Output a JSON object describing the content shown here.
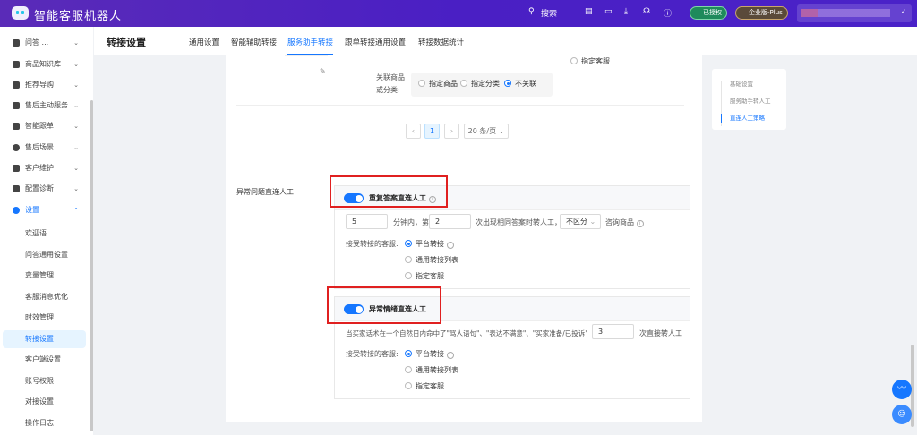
{
  "topbar": {
    "brand": "智能客服机器人",
    "search": "搜索",
    "authorized": "已授权",
    "edition": "企业版-Plus"
  },
  "sidebar": {
    "groups": [
      {
        "label": "问答 ..."
      },
      {
        "label": "商品知识库"
      },
      {
        "label": "推荐导购"
      },
      {
        "label": "售后主动服务"
      },
      {
        "label": "智能跟单"
      },
      {
        "label": "售后场景"
      },
      {
        "label": "客户维护"
      },
      {
        "label": "配置诊断"
      },
      {
        "label": "设置"
      }
    ],
    "sub_items": [
      {
        "label": "欢迎语"
      },
      {
        "label": "问答通用设置"
      },
      {
        "label": "变量管理"
      },
      {
        "label": "客服消息优化"
      },
      {
        "label": "时效管理"
      },
      {
        "label": "转接设置"
      },
      {
        "label": "客户端设置"
      },
      {
        "label": "账号权限"
      },
      {
        "label": "对接设置"
      },
      {
        "label": "操作日志"
      }
    ]
  },
  "header": {
    "title": "转接设置",
    "tabs": [
      {
        "label": "通用设置"
      },
      {
        "label": "智能辅助转接"
      },
      {
        "label": "服务助手转接"
      },
      {
        "label": "跟单转接通用设置"
      },
      {
        "label": "转接数据统计"
      }
    ]
  },
  "upper": {
    "assign_cs": "指定客服",
    "related_label": "关联商品或分类:",
    "related_options": [
      {
        "label": "指定商品"
      },
      {
        "label": "指定分类"
      },
      {
        "label": "不关联"
      }
    ]
  },
  "pagination": {
    "page": "1",
    "page_size": "20 条/页"
  },
  "abnormal": {
    "section_label": "异常问题直连人工",
    "repeat": {
      "title": "重复答案直连人工",
      "minutes": "5",
      "text1": "分钟内，第",
      "count": "2",
      "text2": "次出现相同答案时转人工，",
      "distinguish": "不区分",
      "text3": "咨询商品",
      "accept_label": "接受转接的客服:",
      "options": [
        {
          "label": "平台转接"
        },
        {
          "label": "通用转接列表"
        },
        {
          "label": "指定客服"
        }
      ]
    },
    "emotion": {
      "title": "异常情绪直连人工",
      "desc": "当买家话术在一个自然日内命中了\"骂人语句\"、\"表达不满意\"、\"买家准备/已投诉\"",
      "count": "3",
      "suffix": "次直接转人工",
      "accept_label": "接受转接的客服:",
      "options": [
        {
          "label": "平台转接"
        },
        {
          "label": "通用转接列表"
        },
        {
          "label": "指定客服"
        }
      ]
    }
  },
  "anchor_nav": [
    {
      "label": "基础设置"
    },
    {
      "label": "服务助手转人工"
    },
    {
      "label": "直连人工策略"
    }
  ],
  "colors": {
    "accent": "#1677ff",
    "topbar": "#4a1fc4",
    "highlight": "#e02020"
  }
}
